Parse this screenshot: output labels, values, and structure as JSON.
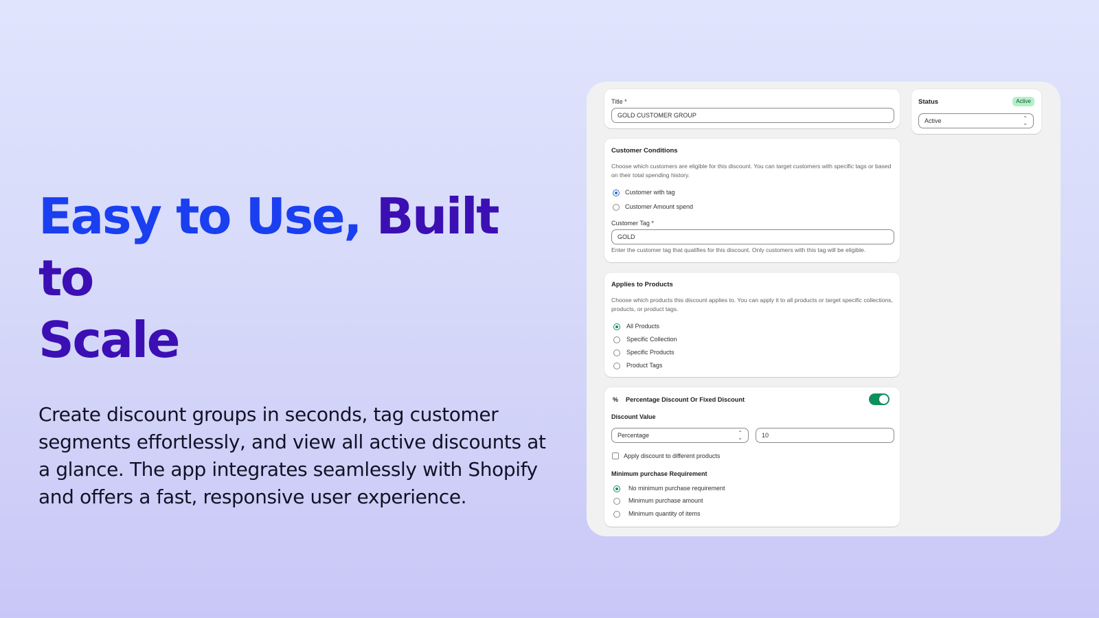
{
  "hero": {
    "headline_part1": "Easy to Use,",
    "headline_part2": "Built to",
    "headline_part3": "Scale",
    "description": "Create discount groups in seconds, tag customer segments effortlessly, and view all active discounts at a glance. The app integrates seamlessly with Shopify and offers a fast, responsive user experience."
  },
  "title_card": {
    "label": "Title *",
    "value": "GOLD  CUSTOMER GROUP"
  },
  "status_card": {
    "label": "Status",
    "badge": "Active",
    "select_value": "Active"
  },
  "customer_conditions": {
    "heading": "Customer Conditions",
    "help": "Choose which customers are eligible for this discount. You can target customers with specific tags or based on their total spending history.",
    "options": [
      {
        "label": "Customer with tag",
        "selected": true
      },
      {
        "label": "Customer Amount spend",
        "selected": false
      }
    ],
    "tag_label": "Customer Tag *",
    "tag_value": "GOLD",
    "tag_help": "Enter the customer tag that qualifies for this discount. Only customers with this tag will be eligible."
  },
  "applies_to_products": {
    "heading": "Applies to Products",
    "help": "Choose which products this discount applies to. You can apply it to all products or target specific collections, products, or product tags.",
    "options": [
      {
        "label": "All Products",
        "selected": true
      },
      {
        "label": "Specific Collection",
        "selected": false
      },
      {
        "label": "Specific Products",
        "selected": false
      },
      {
        "label": "Product Tags",
        "selected": false
      }
    ]
  },
  "discount": {
    "icon": "%",
    "heading": "Percentage Discount Or Fixed Discount",
    "toggle_on": true,
    "value_label": "Discount Value",
    "type_value": "Percentage",
    "amount_value": "10",
    "different_products_label": "Apply discount to different products",
    "different_products_checked": false,
    "min_heading": "Minimum purchase Requirement",
    "min_options": [
      {
        "label": "No minimum purchase requirement",
        "selected": true
      },
      {
        "label": "Minimum purchase amount",
        "selected": false
      },
      {
        "label": "Minimum quantity of items",
        "selected": false
      }
    ]
  },
  "colors": {
    "headline_blue": "#1a3ff0",
    "headline_purple": "#3c0fb4",
    "toggle_green": "#0f8f5c",
    "radio_blue": "#2c6ecb",
    "badge_bg": "#b4f0c8"
  }
}
